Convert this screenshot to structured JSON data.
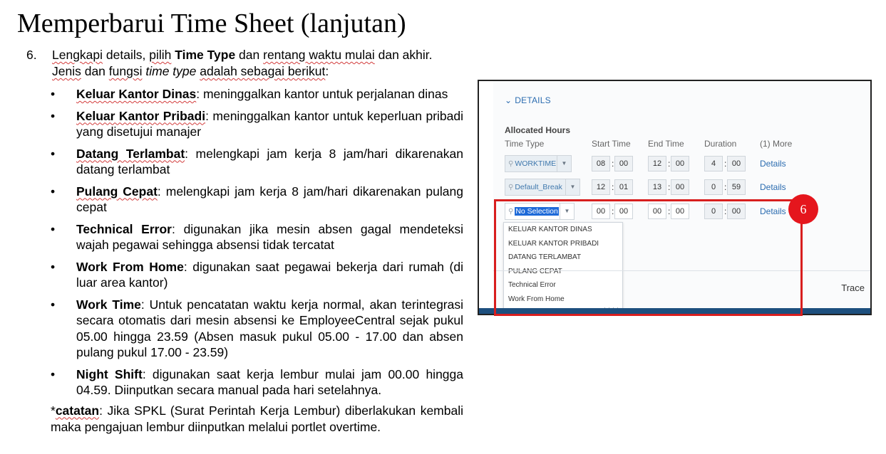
{
  "slide": {
    "title": "Memperbarui Time Sheet (lanjutan)",
    "step_number": "6.",
    "step_intro_a": "Lengkapi",
    "step_intro_b": " details, ",
    "step_intro_c": "pilih",
    "step_intro_d": " ",
    "step_intro_e": "Time Type",
    "step_intro_f": " dan ",
    "step_intro_g": "rentang waktu mulai",
    "step_intro_h": " dan akhir.",
    "step_line2_a": "Jenis",
    "step_line2_b": " dan ",
    "step_line2_c": "fungsi",
    "step_line2_d": " ",
    "step_line2_e": "time type",
    "step_line2_f": " ",
    "step_line2_g": "adalah sebagai berikut",
    "step_line2_h": ":",
    "bullet_glyph": "•",
    "items": [
      {
        "term": "Keluar Kantor Dinas",
        "desc": ": meninggalkan kantor untuk perjalanan dinas"
      },
      {
        "term": "Keluar Kantor Pribadi",
        "desc": ": meninggalkan kantor untuk keperluan pribadi yang disetujui manajer"
      },
      {
        "term": "Datang Terlambat",
        "desc": ": melengkapi jam kerja 8 jam/hari dikarenakan datang terlambat"
      },
      {
        "term": "Pulang Cepat",
        "desc": ": melengkapi jam kerja 8 jam/hari dikarenakan pulang cepat"
      },
      {
        "term": "Technical Error",
        "desc": ": digunakan jika mesin absen gagal mendeteksi wajah pegawai sehingga absensi tidak tercatat"
      },
      {
        "term": "Work From Home",
        "desc": ": digunakan saat pegawai bekerja dari rumah (di luar area kantor)"
      },
      {
        "term": "Work Time",
        "desc": ": Untuk pencatatan waktu kerja normal, akan terintegrasi secara otomatis dari mesin absensi ke EmployeeCentral sejak pukul 05.00 hingga 23.59 (Absen masuk pukul 05.00 - 17.00 dan absen pulang pukul 17.00 - 23.59)"
      },
      {
        "term": "Night Shift",
        "desc": ": digunakan saat kerja lembur mulai jam 00.00 hingga 04.59. Diinputkan secara manual pada hari setelahnya."
      }
    ],
    "note_prefix": "*",
    "note_term": "catatan",
    "note_text": ": Jika SPKL (Surat Perintah Kerja Lembur) diberlakukan kembali maka pengajuan lembur diinputkan melalui portlet overtime."
  },
  "screenshot": {
    "section_label": "DETAILS",
    "allocated_label": "Allocated Hours",
    "col_time_type": "Time Type",
    "col_start": "Start Time",
    "col_end": "End Time",
    "col_duration": "Duration",
    "col_more": "(1) More",
    "colon": ":",
    "details_link": "Details",
    "rows": [
      {
        "type": "WORKTIME",
        "start_h": "08",
        "start_m": "00",
        "end_h": "12",
        "end_m": "00",
        "dur_h": "4",
        "dur_m": "00"
      },
      {
        "type": "Default_Break",
        "start_h": "12",
        "start_m": "01",
        "end_h": "13",
        "end_m": "00",
        "dur_h": "0",
        "dur_m": "59"
      },
      {
        "type": "No Selection",
        "start_h": "00",
        "start_m": "00",
        "end_h": "00",
        "end_m": "00",
        "dur_h": "0",
        "dur_m": "00"
      }
    ],
    "dropdown_options": [
      "KELUAR KANTOR DINAS",
      "KELUAR KANTOR PRIBADI",
      "DATANG TERLAMBAT",
      "PULANG CEPAT",
      "Technical Error",
      "Work From Home"
    ],
    "trace_label": "Trace",
    "badge": "6"
  },
  "colors": {
    "accent_blue": "#2b6cb0",
    "highlight_red": "#d81e1e",
    "badge_red": "#e5161d",
    "selection_blue": "#1e6ad8",
    "bottom_bar": "#1d4f7e"
  },
  "icons": {
    "section_toggle": "chevron-down-icon",
    "type_search": "search-icon",
    "type_dropdown": "caret-down-icon",
    "resize": "resize-grip-icon"
  }
}
